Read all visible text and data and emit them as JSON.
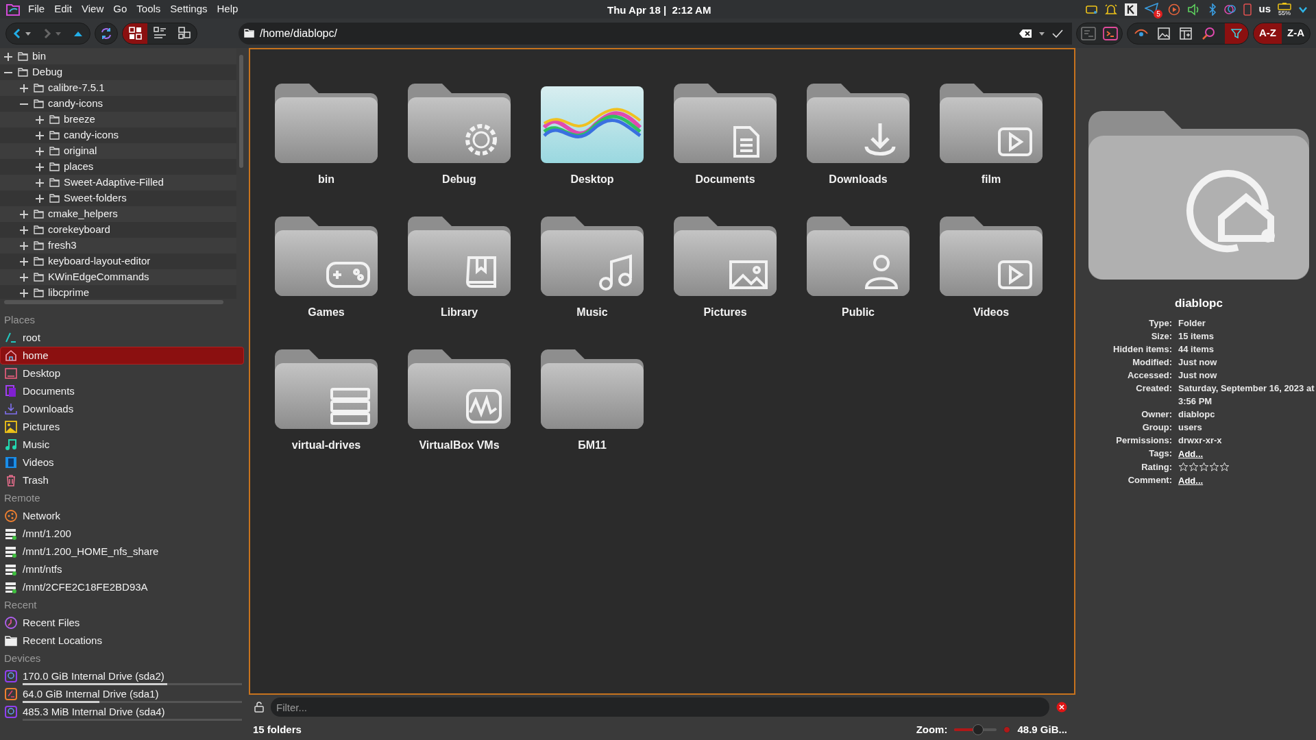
{
  "menu_bar": {
    "menus": [
      "File",
      "Edit",
      "View",
      "Go",
      "Tools",
      "Settings",
      "Help"
    ],
    "clock": "Thu Apr 18 |  2:12 AM",
    "notification_badge": "5",
    "keyboard_layout": "us",
    "battery": "55%"
  },
  "toolbar": {
    "view_modes": [
      {
        "selected": true
      },
      {
        "selected": false
      },
      {
        "selected": false
      }
    ],
    "path": "/home/diablopc/",
    "filter_on": true,
    "sort": [
      {
        "label": "A-Z",
        "selected": true
      },
      {
        "label": "Z-A",
        "selected": false
      }
    ]
  },
  "tree": [
    {
      "label": "bin",
      "expanded": false
    },
    {
      "label": "Debug",
      "expanded": true,
      "children": [
        {
          "label": "calibre-7.5.1",
          "expanded": false
        },
        {
          "label": "candy-icons",
          "expanded": true,
          "children": [
            {
              "label": "breeze",
              "expanded": false
            },
            {
              "label": "candy-icons",
              "expanded": false
            },
            {
              "label": "original",
              "expanded": false
            },
            {
              "label": "places",
              "expanded": false
            },
            {
              "label": "Sweet-Adaptive-Filled",
              "expanded": false
            },
            {
              "label": "Sweet-folders",
              "expanded": false
            }
          ]
        },
        {
          "label": "cmake_helpers",
          "expanded": false
        },
        {
          "label": "corekeyboard",
          "expanded": false
        },
        {
          "label": "fresh3",
          "expanded": false
        },
        {
          "label": "keyboard-layout-editor",
          "expanded": false
        },
        {
          "label": "KWinEdgeCommands",
          "expanded": false
        },
        {
          "label": "libcprime",
          "expanded": false
        }
      ]
    }
  ],
  "places": [
    {
      "title": "Places",
      "items": [
        {
          "label": "root",
          "selected": false
        },
        {
          "label": "home",
          "selected": true
        },
        {
          "label": "Desktop",
          "selected": false
        },
        {
          "label": "Documents",
          "selected": false
        },
        {
          "label": "Downloads",
          "selected": false
        },
        {
          "label": "Pictures",
          "selected": false
        },
        {
          "label": "Music",
          "selected": false
        },
        {
          "label": "Videos",
          "selected": false
        },
        {
          "label": "Trash",
          "selected": false
        }
      ]
    },
    {
      "title": "Remote",
      "items": [
        {
          "label": "Network",
          "selected": false
        },
        {
          "label": "/mnt/1.200",
          "selected": false
        },
        {
          "label": "/mnt/1.200_HOME_nfs_share",
          "selected": false
        },
        {
          "label": "/mnt/ntfs",
          "selected": false
        },
        {
          "label": "/mnt/2CFE2C18FE2BD93A",
          "selected": false
        }
      ]
    },
    {
      "title": "Recent",
      "items": [
        {
          "label": "Recent Files",
          "selected": false
        },
        {
          "label": "Recent Locations",
          "selected": false
        }
      ]
    },
    {
      "title": "Devices",
      "items": [
        {
          "label": "170.0 GiB Internal Drive (sda2)",
          "selected": false,
          "level": 0.66
        },
        {
          "label": "64.0 GiB Internal Drive (sda1)",
          "selected": false,
          "level": 0.35
        },
        {
          "label": "485.3 MiB Internal Drive (sda4)",
          "selected": false,
          "level": 0
        }
      ]
    }
  ],
  "files": [
    {
      "name": "bin",
      "kind": "folder"
    },
    {
      "name": "Debug",
      "kind": "folder"
    },
    {
      "name": "Desktop",
      "kind": "preview"
    },
    {
      "name": "Documents",
      "kind": "folder"
    },
    {
      "name": "Downloads",
      "kind": "folder"
    },
    {
      "name": "film",
      "kind": "folder"
    },
    {
      "name": "Games",
      "kind": "folder"
    },
    {
      "name": "Library",
      "kind": "folder"
    },
    {
      "name": "Music",
      "kind": "folder"
    },
    {
      "name": "Pictures",
      "kind": "folder"
    },
    {
      "name": "Public",
      "kind": "folder"
    },
    {
      "name": "Videos",
      "kind": "folder"
    },
    {
      "name": "virtual-drives",
      "kind": "folder"
    },
    {
      "name": "VirtualBox VMs",
      "kind": "folder"
    },
    {
      "name": "БМ11",
      "kind": "folder"
    }
  ],
  "filter": {
    "placeholder": "Filter..."
  },
  "status_bar": {
    "summary": "15 folders",
    "zoom_label": "Zoom:",
    "zoom": {
      "level": 0.55
    },
    "free_space": "48.9 GiB..."
  },
  "info": {
    "title": "diablopc",
    "properties": [
      {
        "label": "Type:",
        "kind": "text",
        "value": "Folder"
      },
      {
        "label": "Size:",
        "kind": "text",
        "value": "15 items"
      },
      {
        "label": "Hidden items:",
        "kind": "text",
        "value": "44 items"
      },
      {
        "label": "Modified:",
        "kind": "text",
        "value": "Just now"
      },
      {
        "label": "Accessed:",
        "kind": "text",
        "value": "Just now"
      },
      {
        "label": "Created:",
        "kind": "text",
        "value": "Saturday, September 16, 2023 at 3:56 PM"
      },
      {
        "label": "Owner:",
        "kind": "text",
        "value": "diablopc"
      },
      {
        "label": "Group:",
        "kind": "text",
        "value": "users"
      },
      {
        "label": "Permissions:",
        "kind": "text",
        "value": "drwxr-xr-x"
      },
      {
        "label": "Tags:",
        "kind": "link",
        "value": "Add..."
      },
      {
        "label": "Rating:",
        "kind": "rating",
        "stars": 0
      },
      {
        "label": "Comment:",
        "kind": "link",
        "value": "Add..."
      }
    ]
  }
}
